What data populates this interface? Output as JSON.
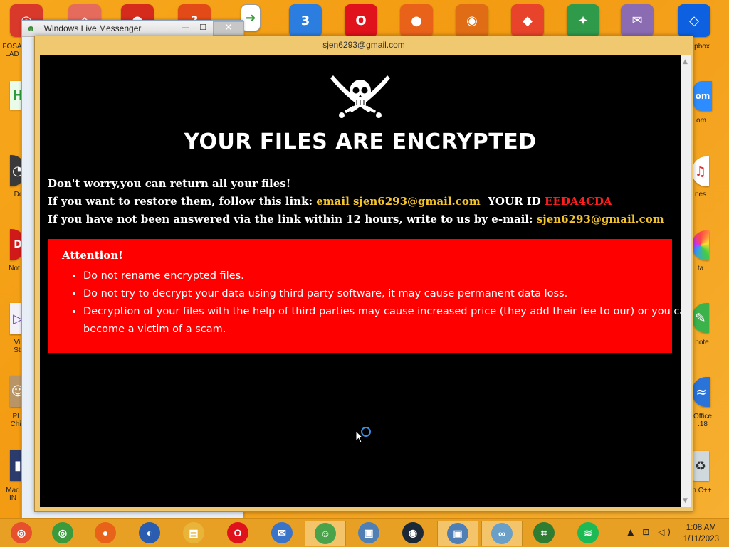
{
  "desktop": {
    "top_icons": [
      {
        "name": "chrome-canary-icon",
        "color": "#d8392b",
        "glyph": "◎"
      },
      {
        "name": "home-app-icon",
        "color": "#e56b5c",
        "glyph": "⌂"
      },
      {
        "name": "red-blob-icon",
        "color": "#d42b1c",
        "glyph": "●"
      },
      {
        "name": "help-icon",
        "color": "#e24a17",
        "glyph": "?"
      },
      {
        "name": "file-icon",
        "color": "#ffffff",
        "glyph": "➜"
      },
      {
        "name": "three-icon",
        "color": "#2c7de0",
        "glyph": "3"
      },
      {
        "name": "opera-icon",
        "color": "#e0121b",
        "glyph": "O"
      },
      {
        "name": "firefox-icon",
        "color": "#e8621a",
        "glyph": "●"
      },
      {
        "name": "eye-icon",
        "color": "#e06d15",
        "glyph": "◉"
      },
      {
        "name": "anydesk-icon",
        "color": "#e8442c",
        "glyph": "◆"
      },
      {
        "name": "hummingbird-icon",
        "color": "#2f9a4a",
        "glyph": "✦"
      },
      {
        "name": "pidgin-icon",
        "color": "#8b6bb1",
        "glyph": "✉"
      },
      {
        "name": "dropbox-icon",
        "color": "#0d61e0",
        "glyph": "◇"
      }
    ],
    "left_labels": [
      "FOSA\nLAD",
      "Do",
      "Not",
      "Vi\nSt",
      "Pl\nChi",
      "Mad\nIN"
    ],
    "right_labels": [
      "pbox",
      "om",
      "nes",
      "ta",
      "note",
      "Office\n.18",
      "n C++"
    ]
  },
  "messenger": {
    "title": "Windows Live Messenger",
    "minimize": "—",
    "maximize": "☐",
    "close": "✕"
  },
  "ransom": {
    "window_title": "sjen6293@gmail.com",
    "headline": "YOUR FILES ARE ENCRYPTED",
    "line1": "Don't worry,you can return all your files!",
    "line2_prefix": "If you want to restore them, follow this link:",
    "line2_link": "email sjen6293@gmail.com",
    "line2_id_label": "YOUR ID",
    "line2_id": "EEDA4CDA",
    "line3_prefix": "If you have not been answered via the link within 12 hours, write to us by e-mail:",
    "line3_email": "sjen6293@gmail.com",
    "attention_title": "Attention!",
    "attention_items": [
      "Do not rename encrypted files.",
      "Do not try to decrypt your data using third party software, it may cause permanent data loss.",
      "Decryption of your files with the help of third parties may cause increased price (they add their fee to our) or you can become a victim of a scam."
    ]
  },
  "taskbar": {
    "items": [
      {
        "name": "taskbar-chrome-canary",
        "color": "#e6502d",
        "glyph": "◎",
        "active": false
      },
      {
        "name": "taskbar-chrome",
        "color": "#3a9a3c",
        "glyph": "◎",
        "active": false
      },
      {
        "name": "taskbar-firefox",
        "color": "#e8621a",
        "glyph": "●",
        "active": false
      },
      {
        "name": "taskbar-obama",
        "color": "#2a5db0",
        "glyph": "◐",
        "active": false
      },
      {
        "name": "taskbar-file-explorer",
        "color": "#e8b43a",
        "glyph": "▤",
        "active": false
      },
      {
        "name": "taskbar-opera",
        "color": "#e0121b",
        "glyph": "O",
        "active": false
      },
      {
        "name": "taskbar-thunderbird",
        "color": "#3a74c8",
        "glyph": "✉",
        "active": false
      },
      {
        "name": "taskbar-messenger",
        "color": "#4aa34a",
        "glyph": "☺",
        "active": true
      },
      {
        "name": "taskbar-remote-desktop",
        "color": "#4f7fb5",
        "glyph": "▣",
        "active": false
      },
      {
        "name": "taskbar-steam",
        "color": "#1b2838",
        "glyph": "◉",
        "active": false
      },
      {
        "name": "taskbar-remote-desktop-2",
        "color": "#4f7fb5",
        "glyph": "▣",
        "active": true
      },
      {
        "name": "taskbar-glasses",
        "color": "#6aa0c8",
        "glyph": "∞",
        "active": true
      },
      {
        "name": "taskbar-greenshot",
        "color": "#2e7d32",
        "glyph": "⌗",
        "active": false
      },
      {
        "name": "taskbar-spotify",
        "color": "#1db954",
        "glyph": "≋",
        "active": false
      }
    ],
    "tray": "▲ ⊡ ◁)",
    "time": "1:08 AM",
    "date": "1/11/2023"
  }
}
